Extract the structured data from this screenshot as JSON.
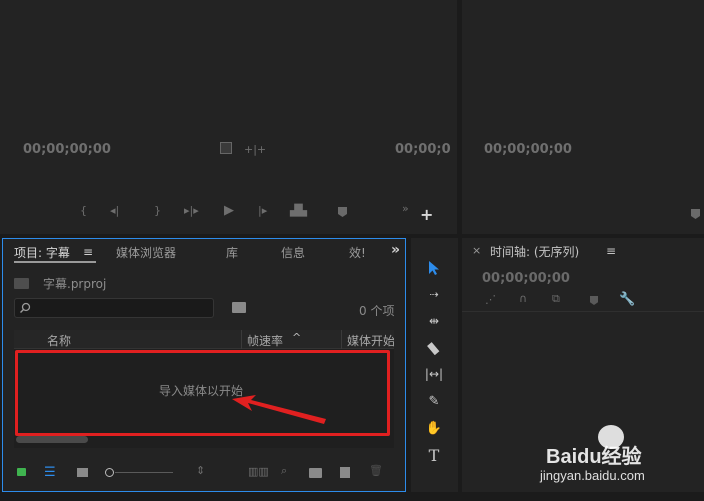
{
  "source_monitor": {
    "timecode_left": "00;00;00;00",
    "timecode_right": "00;00;0"
  },
  "program_monitor": {
    "timecode_left": "00;00;00;00"
  },
  "project_panel": {
    "tabs": [
      "项目: 字幕",
      "媒体浏览器",
      "库",
      "信息",
      "效!"
    ],
    "overflow_label": "»",
    "project_file": "字幕.prproj",
    "search_placeholder": "",
    "item_count": "0 个项",
    "columns": [
      "名称",
      "帧速率",
      "媒体开始"
    ],
    "empty_hint": "导入媒体以开始"
  },
  "timeline_panel": {
    "close_label": "×",
    "title": "时间轴: (无序列)",
    "timecode": "00;00;00;00"
  },
  "watermark": {
    "brand": "Baidu经验",
    "url": "jingyan.baidu.com"
  },
  "colors": {
    "accent_blue": "#2d8ceb",
    "highlight_red": "#e02020",
    "panel_bg": "#232323"
  }
}
